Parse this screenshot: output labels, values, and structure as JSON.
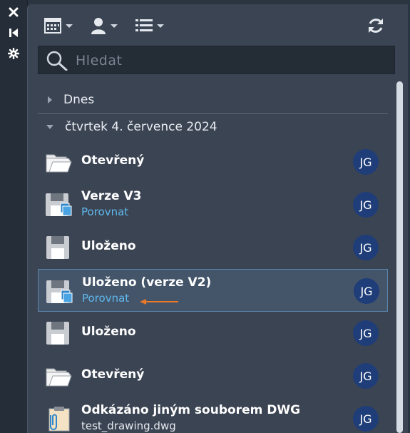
{
  "colors": {
    "accent_link": "#5fb8ec",
    "avatar_bg": "#1f3d78",
    "annotation_arrow": "#e8782a",
    "selected_border": "#5a86ad"
  },
  "strip": {
    "icons": [
      "close-icon",
      "skip-back-icon",
      "settings-gear-icon"
    ]
  },
  "toolbar": {
    "icons": [
      "calendar-icon",
      "user-icon",
      "list-icon",
      "refresh-icon"
    ]
  },
  "search": {
    "placeholder": "Hledat"
  },
  "groups": [
    {
      "label": "Dnes",
      "expanded": false
    },
    {
      "label": "čtvrtek 4. července 2024",
      "expanded": true
    }
  ],
  "entries": [
    {
      "title": "Otevřený",
      "subtitle": "",
      "icon": "folder-open-icon",
      "avatar": "JG",
      "selected": false
    },
    {
      "title": "Verze V3",
      "subtitle": "Porovnat",
      "icon": "save-compare-icon",
      "avatar": "JG",
      "selected": false
    },
    {
      "title": "Uloženo",
      "subtitle": "",
      "icon": "floppy-disk-icon",
      "avatar": "JG",
      "selected": false
    },
    {
      "title": "Uloženo (verze V2)",
      "subtitle": "Porovnat",
      "icon": "save-compare-icon",
      "avatar": "JG",
      "selected": true
    },
    {
      "title": "Uloženo",
      "subtitle": "",
      "icon": "floppy-disk-icon",
      "avatar": "JG",
      "selected": false
    },
    {
      "title": "Otevřený",
      "subtitle": "",
      "icon": "folder-open-icon",
      "avatar": "JG",
      "selected": false
    },
    {
      "title": "Odkázáno jiným souborem DWG",
      "subtitle": "test_drawing.dwg",
      "icon": "attachment-clipboard-icon",
      "avatar": "JG",
      "selected": false
    }
  ]
}
